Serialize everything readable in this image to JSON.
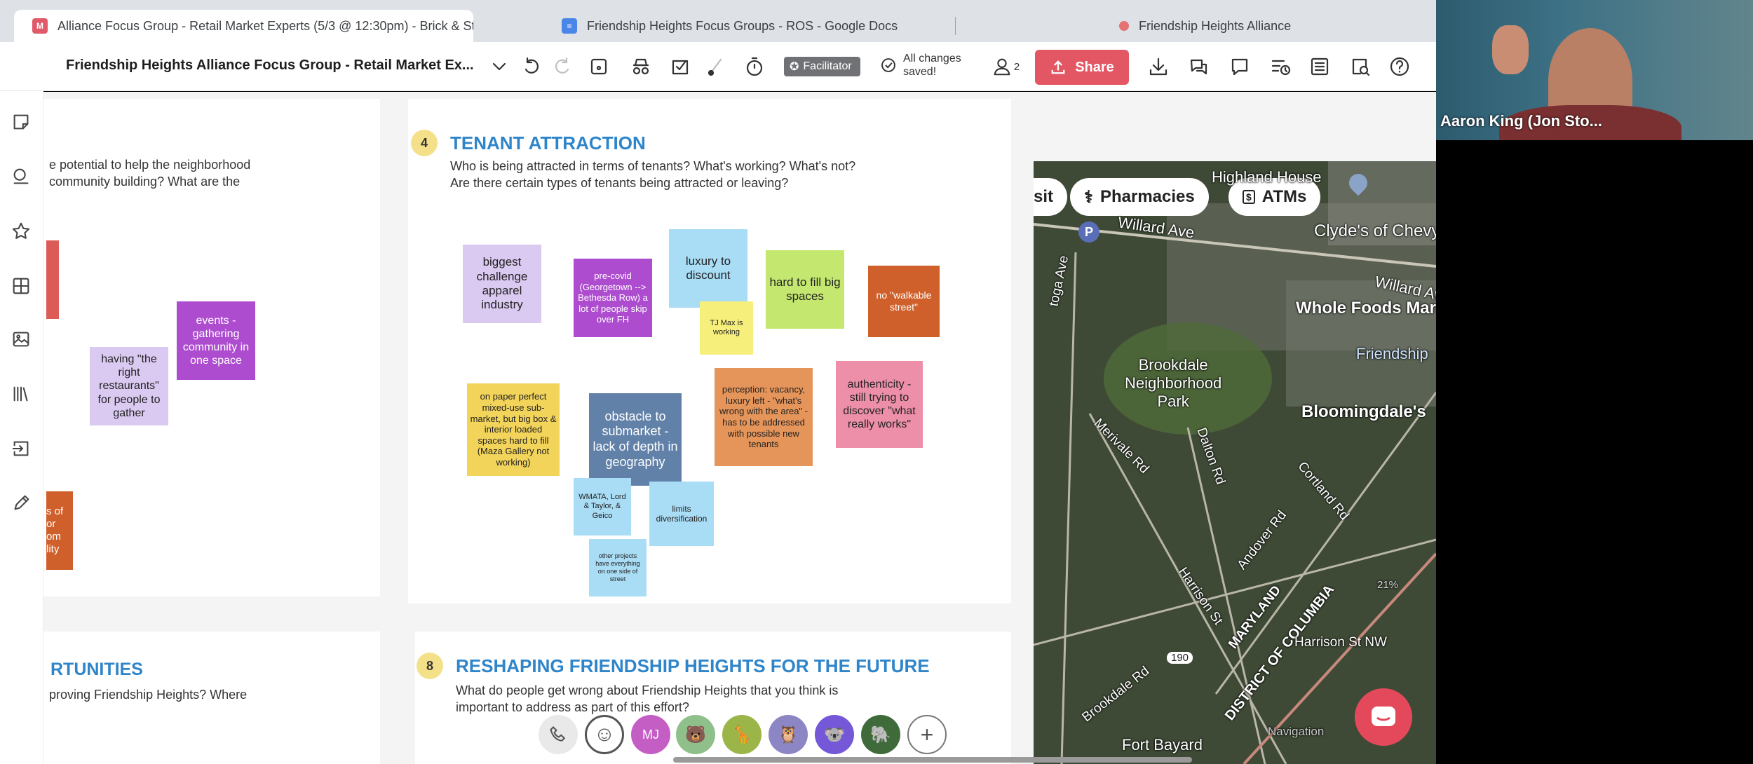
{
  "browser": {
    "tabs": [
      {
        "title": "Alliance Focus Group - Retail Market Experts (5/3 @ 12:30pm) - Brick & Story",
        "favicon": "M"
      },
      {
        "title": "Friendship Heights Focus Groups - ROS - Google Docs",
        "favicon": "docs-icon"
      },
      {
        "title": "Friendship Heights Alliance",
        "favicon": "dot"
      }
    ]
  },
  "toolbar": {
    "board_title": "Friendship Heights Alliance Focus Group - Retail Market Ex...",
    "facilitator_label": "Facilitator",
    "saved_line1": "All changes",
    "saved_line2": "saved!",
    "participants_count": "2",
    "share_label": "Share"
  },
  "sidebar": {
    "avatar_initials": "MJ"
  },
  "frames": {
    "left_top_q_line1": "e potential to help the neighborhood",
    "left_top_q_line2": "community building?  What are the",
    "left_bottom_title": "RTUNITIES",
    "left_bottom_q": "proving Friendship Heights? Where",
    "tenant": {
      "number": "4",
      "title": "TENANT ATTRACTION",
      "question_line1": "Who is being attracted in terms of tenants?  What's working? What's not?",
      "question_line2": "Are there certain types of tenants being attracted or leaving?"
    },
    "reshaping": {
      "number": "8",
      "title": "RESHAPING FRIENDSHIP HEIGHTS FOR THE FUTURE",
      "question_line1": "What do people get wrong about Friendship Heights that you think is",
      "question_line2": "important to address as part of this effort?"
    }
  },
  "stickies": {
    "events": "events - gathering community in one space",
    "restaurants": "having \"the right restaurants\" for people to gather",
    "biggest": "biggest challenge apparel industry",
    "precovid": "pre-covid (Georgetown --> Bethesda Row) a lot of people skip over FH",
    "luxury": "luxury to discount",
    "tjmax": "TJ Max is working",
    "hardfill": "hard to fill big spaces",
    "walkable": "no \"walkable street\"",
    "paper": "on paper perfect mixed-use sub-market, but big box & interior loaded spaces hard to fill (Maza Gallery not working)",
    "obstacle": "obstacle to submarket - lack of depth in geography",
    "perception": "perception: vacancy, luxury left - \"what's wrong with the area\" - has to be addressed with possible new tenants",
    "authenticity": "authenticity - still trying to discover \"what really works\"",
    "wmata": "WMATA, Lord & Taylor, & Geico",
    "limits": "limits diversification",
    "other": "other projects have everything on one side of street",
    "left_red_partial": "",
    "left_orange_partial": "s of\nor\nom\nlity"
  },
  "map": {
    "chip_transit": "sit",
    "chip_pharmacies": "Pharmacies",
    "chip_atms": "ATMs",
    "labels": {
      "highland": "Highland House",
      "willard": "Willard Ave",
      "clydes": "Clyde's of Chevy",
      "willard2": "Willard Ave",
      "wholefoods": "Whole Foods Mark",
      "friendship": "Friendship",
      "saratoga": "toga Ave",
      "brookdale_park": "Brookdale\nNeighborhood\nPark",
      "bloomingdales": "Bloomingdale's",
      "merivale": "Merivale Rd",
      "dalton": "Dalton Rd",
      "cortland": "Cortland Rd",
      "andover": "Andover Rd",
      "harrison": "Harrison St",
      "maryland": "MARYLAND",
      "dc": "DISTRICT OF COLUMBIA",
      "brookdale_rd": "Brookdale Rd",
      "route": "190",
      "harrison_nw": "Harrison St NW",
      "fort_bayard": "Fort Bayard",
      "pct": "21%",
      "navigation": "Navigation"
    }
  },
  "presence": {
    "mj_initials": "MJ"
  },
  "video": {
    "participant_name": "Aaron King (Jon Sto..."
  },
  "colors": {
    "share": "#e35663",
    "title_blue": "#2f85c9",
    "badge_yellow": "#f5e08a"
  }
}
